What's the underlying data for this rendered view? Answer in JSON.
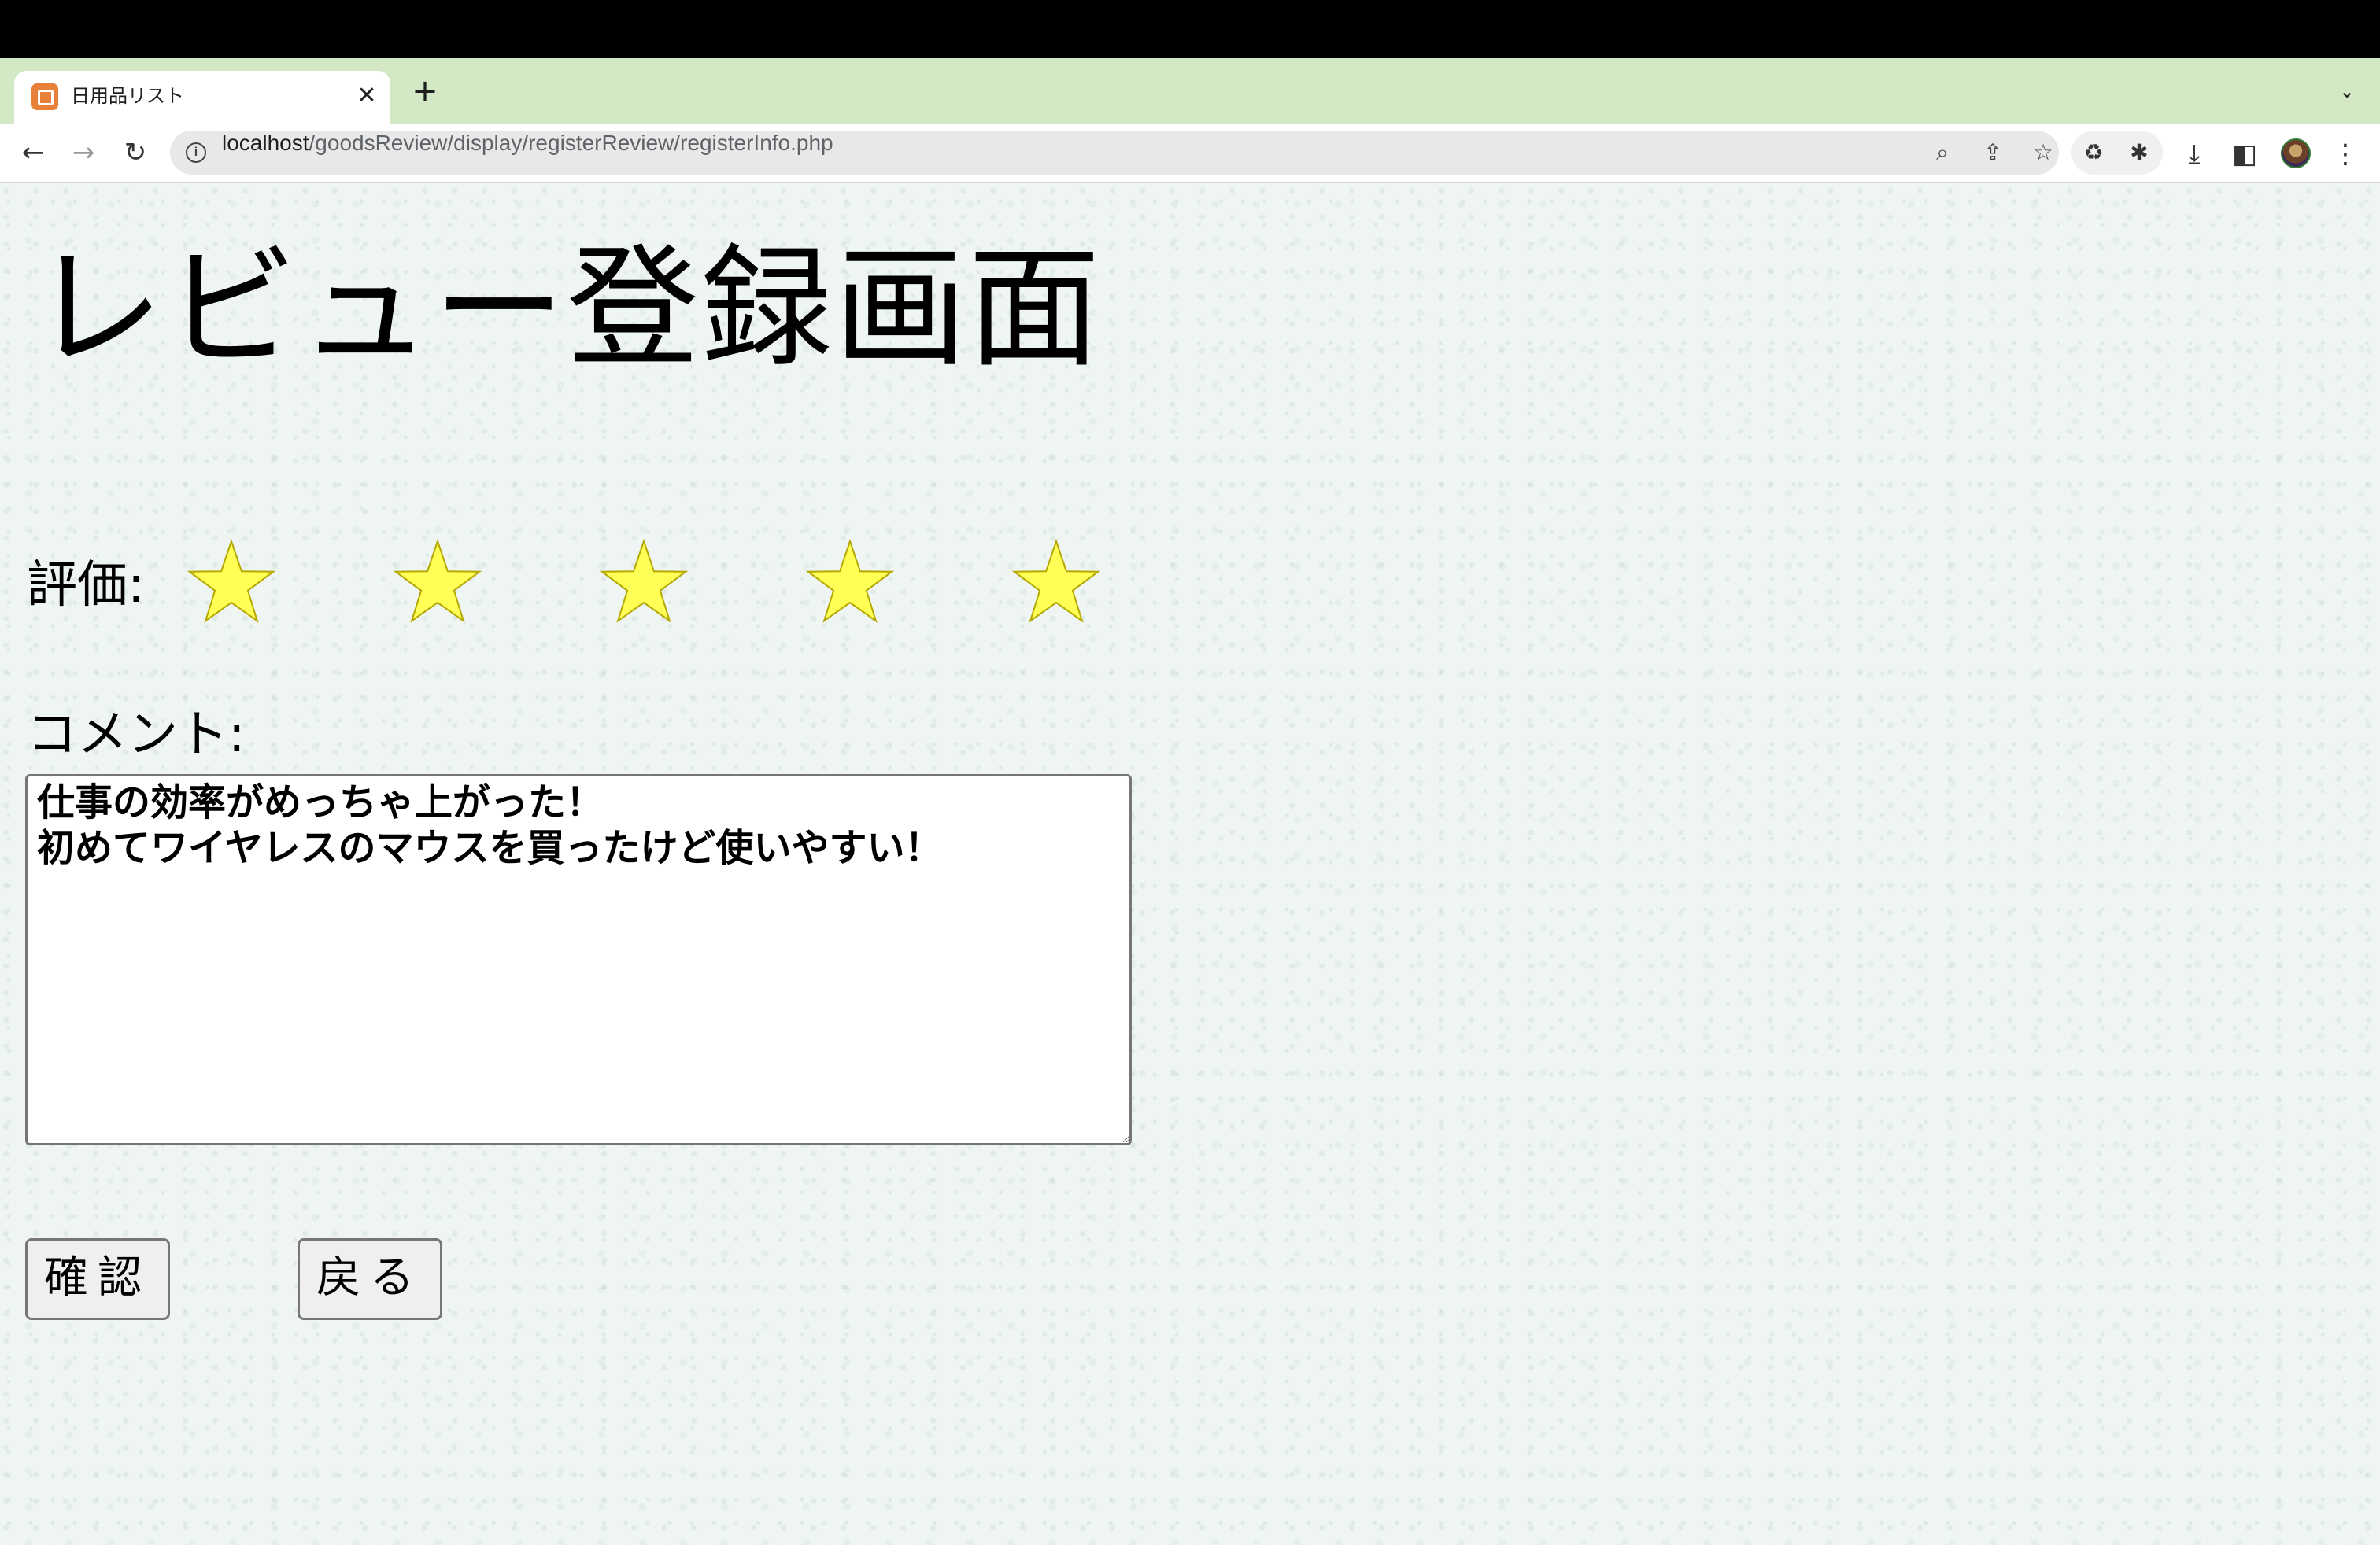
{
  "browser": {
    "tab": {
      "title": "日用品リスト",
      "favicon": "xampp-icon"
    },
    "url_host": "localhost",
    "url_path": "/goodsReview/display/registerReview/registerInfo.php"
  },
  "page": {
    "title": "レビュー登録画面",
    "rating": {
      "label": "評価:",
      "stars_filled": 5,
      "stars_total": 5,
      "star_color": "#ffff55",
      "star_stroke": "#b5a800"
    },
    "comment": {
      "label": "コメント:",
      "value": "仕事の効率がめっちゃ上がった！\n初めてワイヤレスのマウスを買ったけど使いやすい！"
    },
    "buttons": {
      "confirm": "確認",
      "back": "戻る"
    }
  }
}
